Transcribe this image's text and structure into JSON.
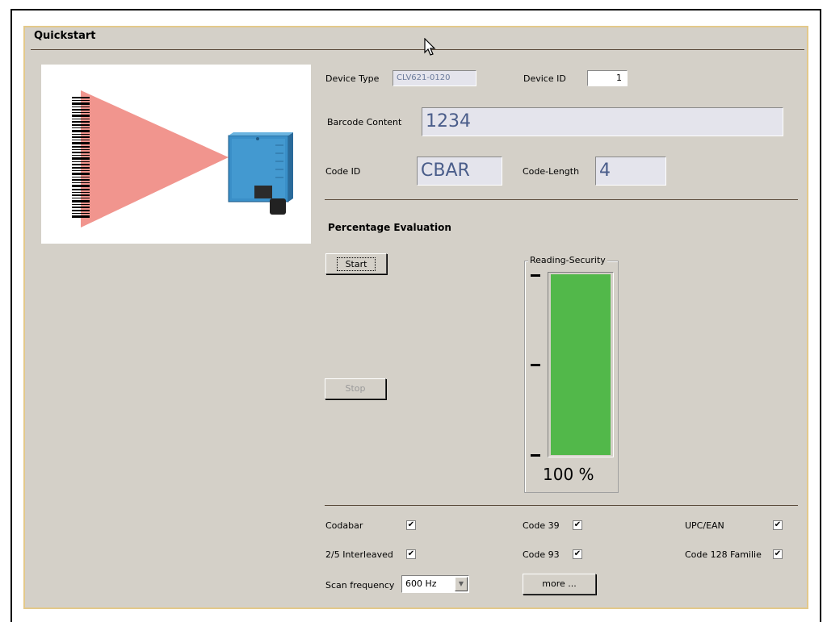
{
  "window": {
    "title": "Quickstart"
  },
  "device": {
    "type_label": "Device Type",
    "type_value": "CLV621-0120",
    "id_label": "Device ID",
    "id_value": "1"
  },
  "barcode": {
    "content_label": "Barcode Content",
    "content_value": "1234",
    "code_id_label": "Code ID",
    "code_id_value": "CBAR",
    "code_length_label": "Code-Length",
    "code_length_value": "4"
  },
  "evaluation": {
    "heading": "Percentage Evaluation",
    "start_label": "Start",
    "stop_label": "Stop",
    "gauge_legend": "Reading-Security",
    "gauge_percent": 100,
    "gauge_text": "100 %",
    "gauge_color": "#52b84a"
  },
  "codes": [
    {
      "label": "Codabar",
      "checked": true
    },
    {
      "label": "Code 39",
      "checked": true
    },
    {
      "label": "UPC/EAN",
      "checked": true
    },
    {
      "label": "2/5 Interleaved",
      "checked": true
    },
    {
      "label": "Code 93",
      "checked": true
    },
    {
      "label": "Code 128 Familie",
      "checked": true
    }
  ],
  "scan": {
    "label": "Scan frequency",
    "value": "600 Hz",
    "more_label": "more ..."
  },
  "colors": {
    "panel_bg": "#d4d0c8",
    "panel_border": "#e3c98a",
    "laser": "#f08a82",
    "scanner": "#3a8fc8"
  },
  "icons": [
    "barcode-scanner-illustration",
    "mouse-cursor-icon",
    "dropdown-arrow-icon",
    "checkmark-icon"
  ]
}
